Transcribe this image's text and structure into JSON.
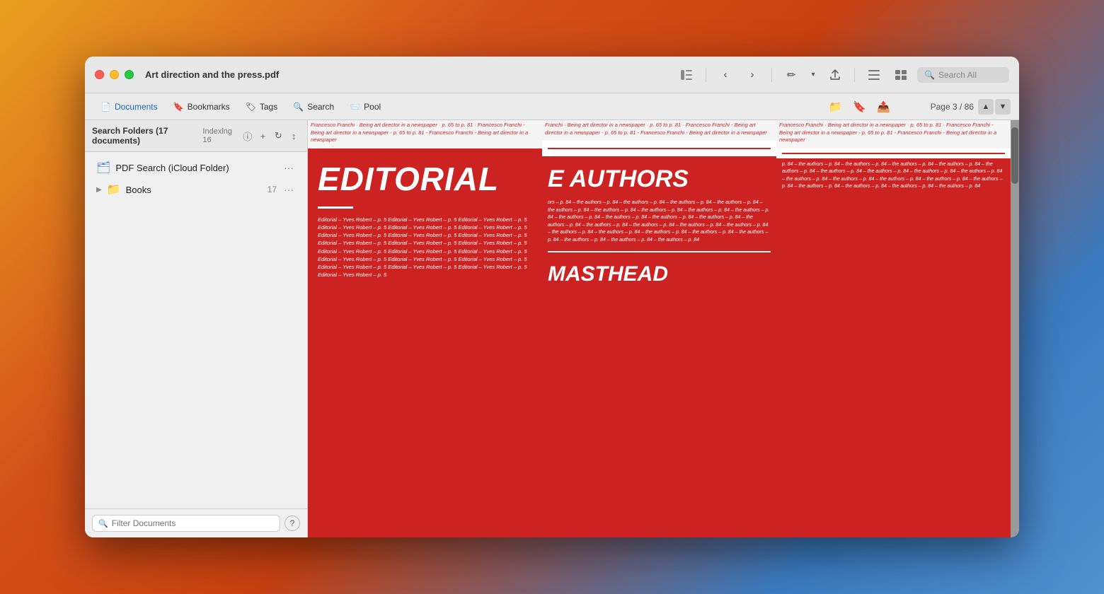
{
  "window": {
    "title": "Art direction and the press.pdf",
    "traffic_lights": {
      "close": "close",
      "minimize": "minimize",
      "maximize": "maximize"
    }
  },
  "titlebar": {
    "sidebar_toggle_icon": "☰",
    "back_icon": "‹",
    "forward_icon": "›",
    "annotate_icon": "✏",
    "share_icon": "↑",
    "list_icon": "☰",
    "sidebar_icon": "▭",
    "search_placeholder": "Search All"
  },
  "toolbar2": {
    "tabs": [
      {
        "id": "documents",
        "label": "Documents",
        "icon": "📄",
        "active": true
      },
      {
        "id": "bookmarks",
        "label": "Bookmarks",
        "icon": "🔖",
        "active": false
      },
      {
        "id": "tags",
        "label": "Tags",
        "icon": "🏷",
        "active": false
      },
      {
        "id": "search",
        "label": "Search",
        "icon": "🔍",
        "active": false
      },
      {
        "id": "pool",
        "label": "Pool",
        "icon": "📨",
        "active": false
      }
    ],
    "right_icons": [
      "📁",
      "🔖",
      "📤"
    ],
    "page_label": "Page 3 / 86"
  },
  "sidebar": {
    "header_label": "Search Folders (17 documents)",
    "indexing_label": "Indexing 16",
    "add_icon": "+",
    "refresh_icon": "↻",
    "sort_icon": "↕",
    "items": [
      {
        "id": "icloud",
        "label": "PDF Search (iCloud Folder)",
        "icon": "🗂",
        "has_chevron": false,
        "count": null,
        "menu_dots": "···"
      },
      {
        "id": "books",
        "label": "Books",
        "icon": "📁",
        "has_chevron": true,
        "count": "17",
        "menu_dots": "···"
      }
    ],
    "filter_placeholder": "Filter Documents",
    "help_label": "?"
  },
  "pdf": {
    "page_label": "Page 3 / 86",
    "columns": [
      {
        "id": "col1",
        "top_text": "Francesco Franchi · Being art director in a newspaper · p. 65 to p. 81 · Francesco Franchi - Being art director in a newspaper - p. 65 to p. 81 - Francesco Franchi - Being art director in a newspaper",
        "editorial_title": "EDITORIAL",
        "body_text": "Editorial – Yves Robert – p. 5 Editorial – Yves Robert – p. 5 Editorial – Yves Robert – p. 5 Editorial – Yves Robert – p. 5 Editorial – Yves Robert – p. 5 Editorial – Yves Robert – p. 5 Editorial – Yves Robert – p. 5 Editorial – Yves Robert – p. 5 Editorial – Yves Robert – p. 5 Editorial – Yves Robert – p. 5 Editorial – Yves Robert – p. 5 Editorial – Yves Robert – p. 5 Editorial – Yves Robert – p. 5 Editorial – Yves Robert – p. 5 Editorial – Yves Robert – p. 5 Editorial – Yves Robert – p. 5 Editorial – Yves Robert – p. 5 Editorial – Yves Robert – p. 5 Editorial – Yves Robert – p. 5 Editorial – Yves Robert – p. 5 Editorial – Yves Robert – p. 5 Editorial – Yves Robert – p. 5"
      },
      {
        "id": "col2",
        "top_text": "Franchi · Being art director in a newspaper · p. 65 to p. 81 · Francesco Franchi - Being art director in a newspaper - p. 65 to p. 81 - Francesco Franchi - Being art director in a newspaper",
        "authors_title": "E AUTHORS",
        "body_text": "ors – p. 84 – the authors – p. 84 – the authors – p. 84 – the authors – p. 84 – the authors – p. 84 – the authors – p. 84 – the authors – p. 84 – the authors – p. 84 – the authors – p. 84 – the authors – p. 84 – the authors – p. 84 – the authors – p. 84 – the authors – p. 84 – the authors – p. 84 – the authors – p. 84 – the authors – p. 84 – the authors – p. 84 – the authors – p. 84 – the authors – p. 84 – the authors – p. 84 – the authors – p. 84 – the authors – p. 84 – the authors – p. 84 – the authors – p. 84 – the authors – p. 84 – the authors – p. 84 – the authors – p. 84",
        "masthead_title": "MASTHEAD"
      },
      {
        "id": "col3",
        "top_text": "Francesco Franchi · Being art director in a newspaper · p. 65 to p. 81 · Francesco Franchi - Being art director in a newspaper - p. 65 to p. 81 - Francesco Franchi - Being art director in a newspaper",
        "body_text": "p. 84 – the authors – p. 84 – the authors – p. 84 – the authors – p. 84 – the authors – p. 84 – the authors – p. 84 – the authors – p. 84 – the authors – p. 84 – the authors – p. 84 – the authors – p. 84 – the authors – p. 84 – the authors – p. 84 – the authors – p. 84 – the authors – p. 84 – the authors – p. 84 – the authors – p. 84 – the authors – p. 84 – the authors – p. 84 – the authors – p. 84"
      }
    ]
  }
}
